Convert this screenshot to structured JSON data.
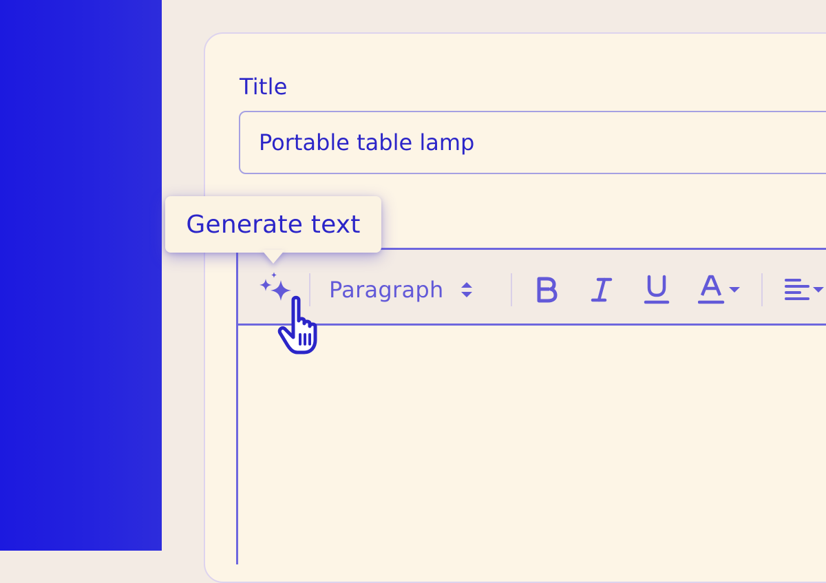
{
  "form": {
    "title_label": "Title",
    "title_value": "Portable table lamp"
  },
  "tooltip": {
    "text": "Generate text"
  },
  "toolbar": {
    "ai_icon": "sparkles-icon",
    "block_format": "Paragraph",
    "buttons": [
      "bold-icon",
      "italic-icon",
      "underline-icon",
      "text-color-icon",
      "align-left-icon"
    ]
  },
  "colors": {
    "accent": "#2b25c8",
    "toolbar_icon": "#6259d8",
    "border": "#6e67de",
    "left_strip": "#1c19df",
    "card_bg": "#fdf5e6"
  }
}
